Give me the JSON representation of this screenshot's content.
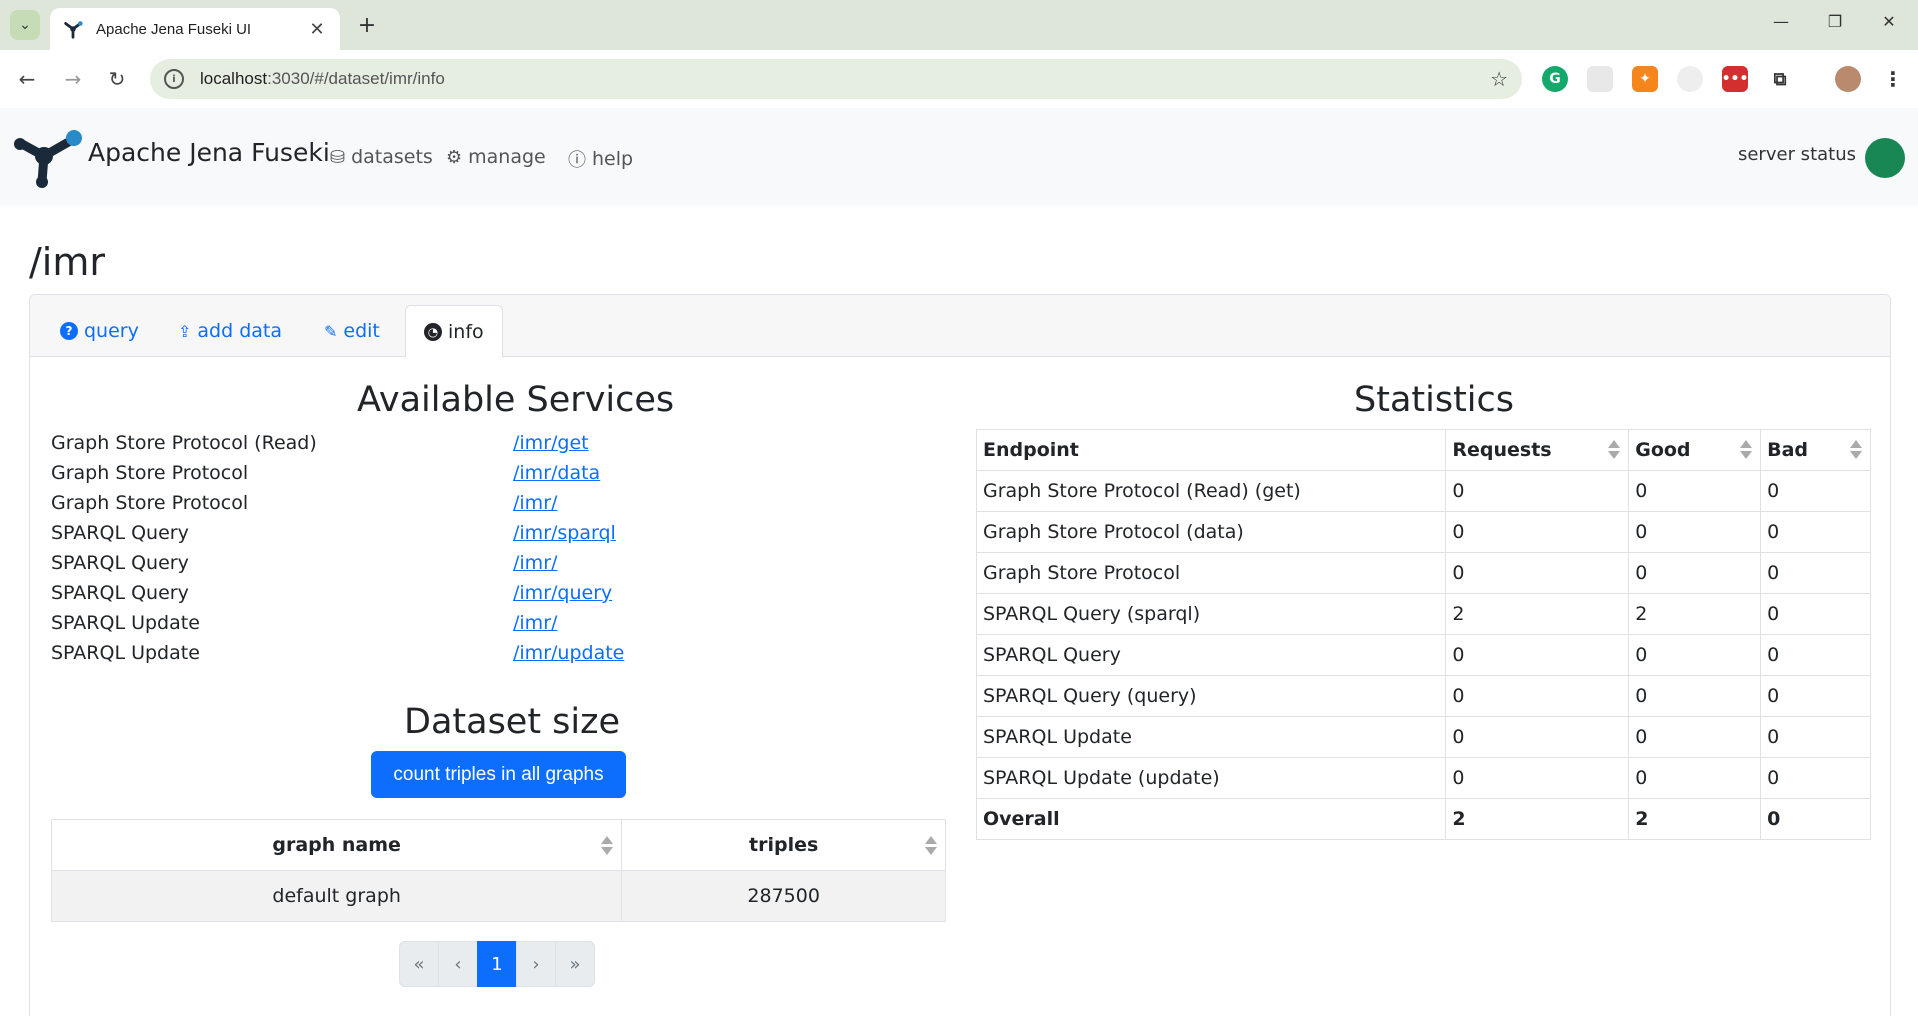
{
  "browser": {
    "tab_title": "Apache Jena Fuseki UI",
    "url_host": "localhost",
    "url_rest": ":3030/#/dataset/imr/info"
  },
  "app": {
    "brand": "Apache Jena Fuseki",
    "nav": {
      "datasets": "datasets",
      "manage": "manage",
      "help": "help"
    },
    "server_status_label": "server status",
    "server_status_color": "#198754"
  },
  "page": {
    "title": "/imr",
    "tabs": {
      "query": "query",
      "add_data": "add data",
      "edit": "edit",
      "info": "info"
    }
  },
  "services": {
    "heading": "Available Services",
    "items": [
      {
        "name": "Graph Store Protocol (Read)",
        "link": "/imr/get"
      },
      {
        "name": "Graph Store Protocol",
        "link": "/imr/data"
      },
      {
        "name": "Graph Store Protocol",
        "link": "/imr/"
      },
      {
        "name": "SPARQL Query",
        "link": "/imr/sparql"
      },
      {
        "name": "SPARQL Query",
        "link": "/imr/"
      },
      {
        "name": "SPARQL Query",
        "link": "/imr/query"
      },
      {
        "name": "SPARQL Update",
        "link": "/imr/"
      },
      {
        "name": "SPARQL Update",
        "link": "/imr/update"
      }
    ]
  },
  "dataset_size": {
    "heading": "Dataset size",
    "button": "count triples in all graphs",
    "columns": {
      "graph_name": "graph name",
      "triples": "triples"
    },
    "rows": [
      {
        "graph_name": "default graph",
        "triples": "287500"
      }
    ],
    "pager": {
      "first": "«",
      "prev": "‹",
      "current": "1",
      "next": "›",
      "last": "»"
    }
  },
  "statistics": {
    "heading": "Statistics",
    "columns": {
      "endpoint": "Endpoint",
      "requests": "Requests",
      "good": "Good",
      "bad": "Bad"
    },
    "rows": [
      {
        "endpoint": "Graph Store Protocol (Read) (get)",
        "requests": "0",
        "good": "0",
        "bad": "0"
      },
      {
        "endpoint": "Graph Store Protocol (data)",
        "requests": "0",
        "good": "0",
        "bad": "0"
      },
      {
        "endpoint": "Graph Store Protocol",
        "requests": "0",
        "good": "0",
        "bad": "0"
      },
      {
        "endpoint": "SPARQL Query (sparql)",
        "requests": "2",
        "good": "2",
        "bad": "0"
      },
      {
        "endpoint": "SPARQL Query",
        "requests": "0",
        "good": "0",
        "bad": "0"
      },
      {
        "endpoint": "SPARQL Query (query)",
        "requests": "0",
        "good": "0",
        "bad": "0"
      },
      {
        "endpoint": "SPARQL Update",
        "requests": "0",
        "good": "0",
        "bad": "0"
      },
      {
        "endpoint": "SPARQL Update (update)",
        "requests": "0",
        "good": "0",
        "bad": "0"
      }
    ],
    "overall": {
      "endpoint": "Overall",
      "requests": "2",
      "good": "2",
      "bad": "0"
    }
  }
}
